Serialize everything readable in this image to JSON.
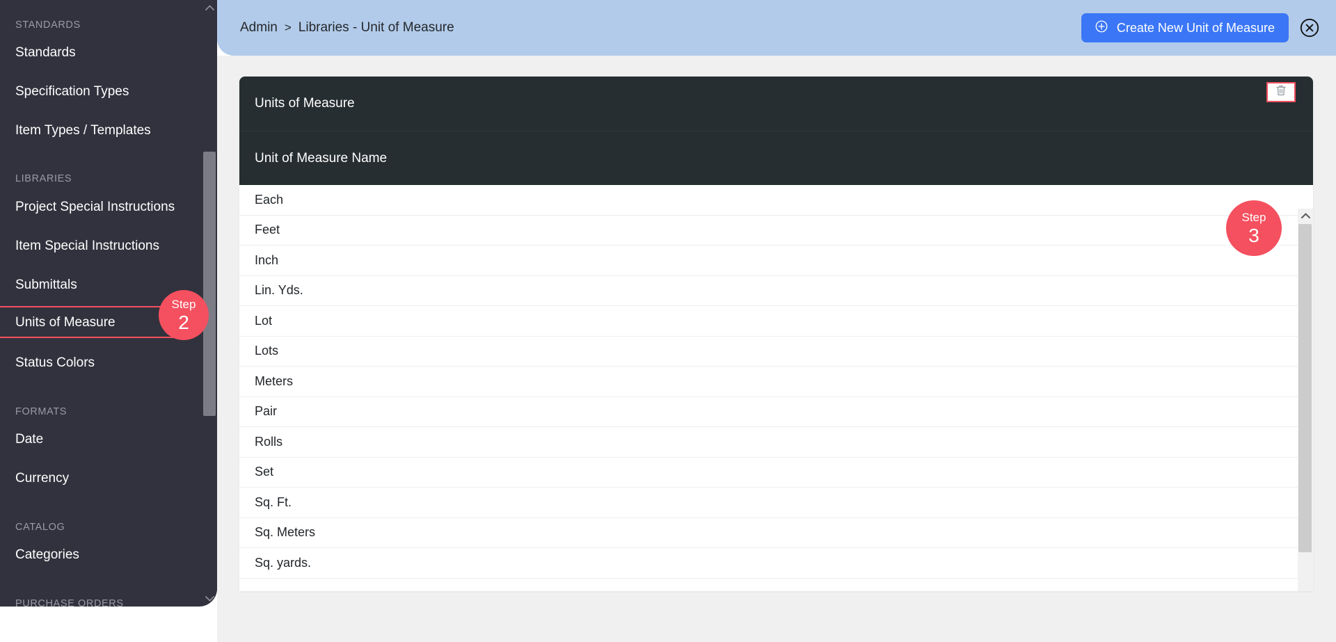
{
  "sidebar": {
    "sections": [
      {
        "label": "STANDARDS",
        "items": [
          "Standards",
          "Specification Types",
          "Item Types / Templates"
        ]
      },
      {
        "label": "LIBRARIES",
        "items": [
          "Project Special Instructions",
          "Item Special Instructions",
          "Submittals",
          "Units of Measure",
          "Status Colors"
        ]
      },
      {
        "label": "FORMATS",
        "items": [
          "Date",
          "Currency"
        ]
      },
      {
        "label": "CATALOG",
        "items": [
          "Categories"
        ]
      },
      {
        "label": "PURCHASE ORDERS",
        "items": []
      }
    ],
    "active_item": "Units of Measure",
    "scroll_up_icon": "chevron-up-icon",
    "scroll_down_icon": "chevron-down-icon"
  },
  "header": {
    "breadcrumb": {
      "root": "Admin",
      "separator": ">",
      "current": "Libraries - Unit of Measure"
    },
    "create_button": {
      "label": "Create New Unit of Measure",
      "icon": "plus-circle-icon"
    },
    "close_icon": "close-circle-icon",
    "bar_color": "#b2cbea",
    "button_color": "#3b76f6"
  },
  "card": {
    "title": "Units of Measure",
    "column_header": "Unit of Measure Name",
    "header_color": "#262e31",
    "rows": [
      "Each",
      "Feet",
      "Inch",
      "Lin. Yds.",
      "Lot",
      "Lots",
      "Meters",
      "Pair",
      "Rolls",
      "Set",
      "Sq. Ft.",
      "Sq. Meters",
      "Sq. yards."
    ],
    "delete_icon": "trash-icon",
    "scroll_up_icon": "chevron-up-icon",
    "scroll_down_icon": "chevron-down-icon"
  },
  "steps": [
    {
      "id": "step2",
      "word": "Step",
      "number": "2",
      "color": "#f4505f"
    },
    {
      "id": "step3",
      "word": "Step",
      "number": "3",
      "color": "#f4505f"
    }
  ]
}
